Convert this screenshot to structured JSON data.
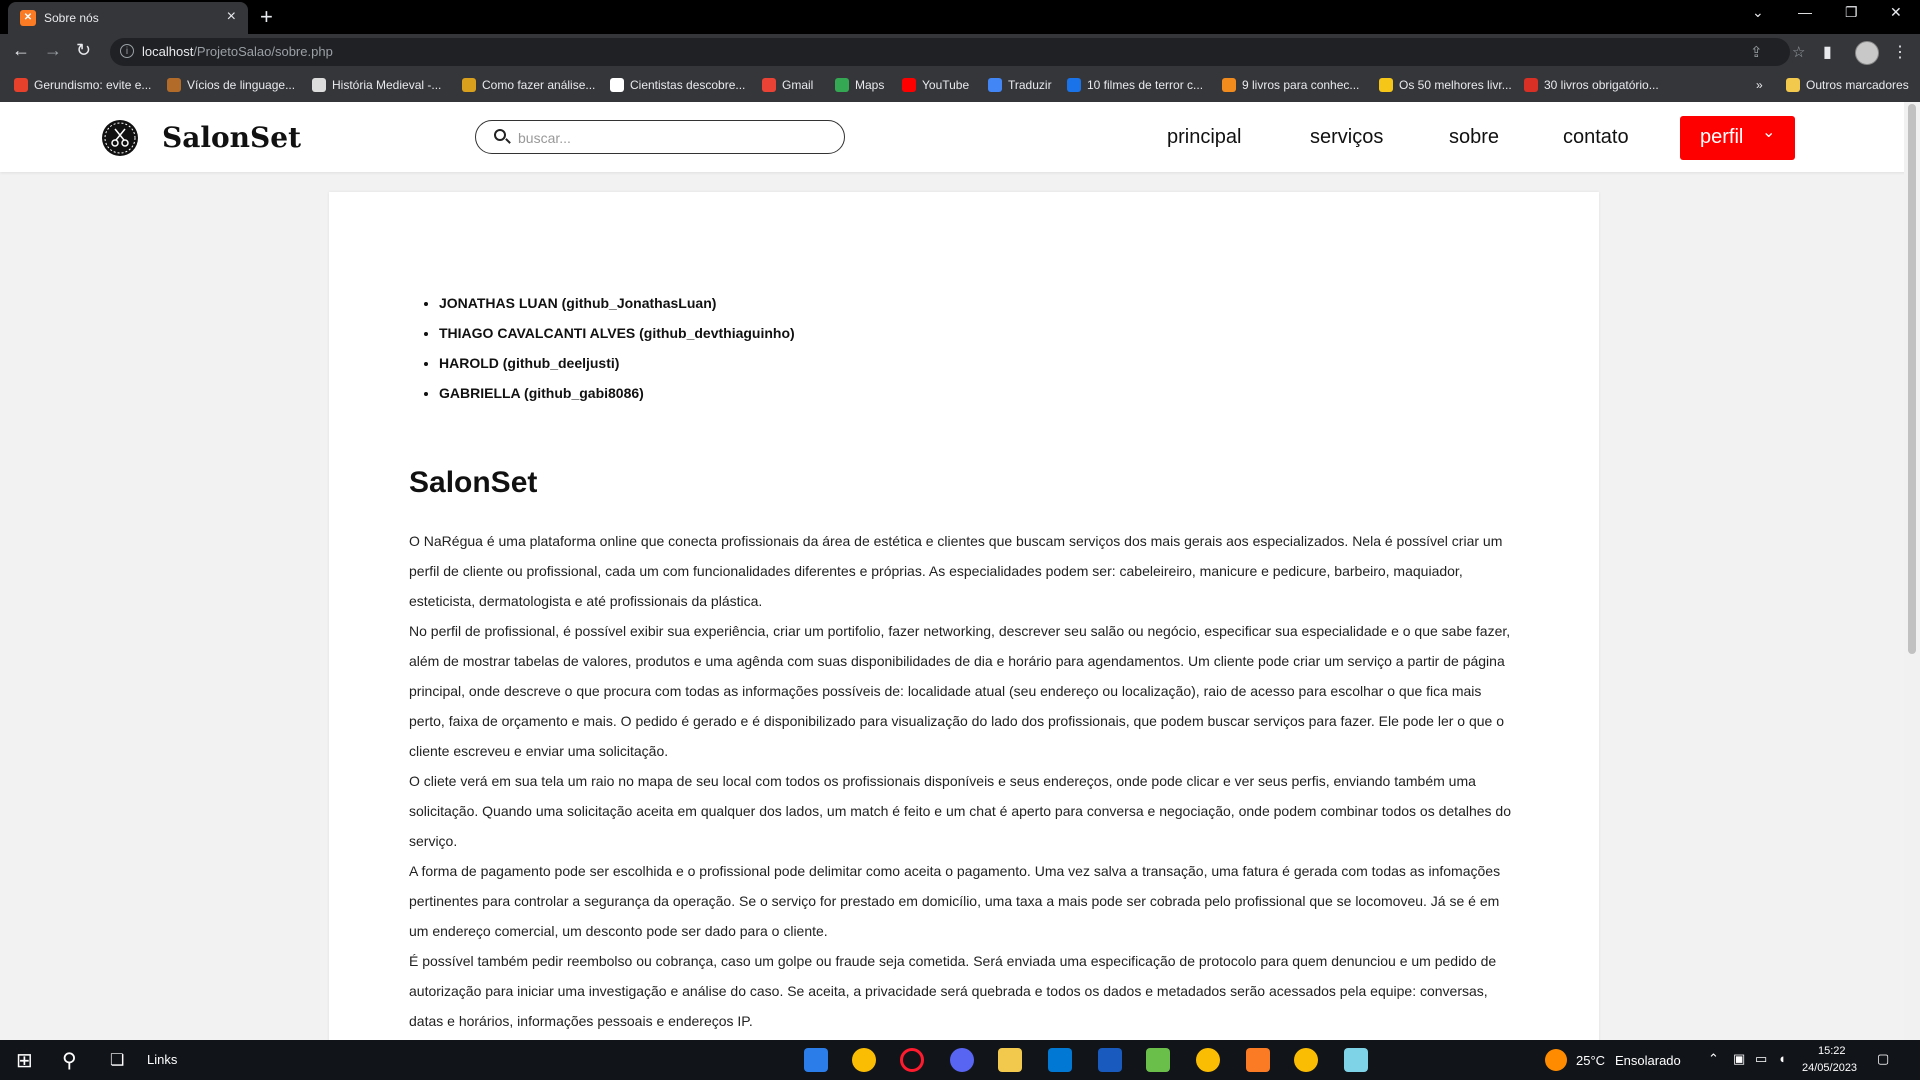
{
  "browser": {
    "tab_title": "Sobre nós",
    "url_host": "localhost",
    "url_path": "/ProjetoSalao/sobre.php",
    "bookmarks": [
      {
        "label": "Gerundismo: evite e...",
        "color": "#e8412b"
      },
      {
        "label": "Vícios de linguage...",
        "color": "#b36b2a"
      },
      {
        "label": "História Medieval -...",
        "color": "#dddddd"
      },
      {
        "label": "Como fazer análise...",
        "color": "#d9a01e"
      },
      {
        "label": "Cientistas descobre...",
        "color": "#ffffff"
      },
      {
        "label": "Gmail",
        "color": "#ea4335"
      },
      {
        "label": "Maps",
        "color": "#34a853"
      },
      {
        "label": "YouTube",
        "color": "#ff0000"
      },
      {
        "label": "Traduzir",
        "color": "#4285f4"
      },
      {
        "label": "10 filmes de terror c...",
        "color": "#1a73e8"
      },
      {
        "label": "9 livros para conhec...",
        "color": "#f28b1e"
      },
      {
        "label": "Os 50 melhores livr...",
        "color": "#f5c518"
      },
      {
        "label": "30 livros obrigatório...",
        "color": "#d93025"
      }
    ],
    "other_bookmarks": "Outros marcadores"
  },
  "site": {
    "logo": "SalonSet",
    "search_placeholder": "buscar...",
    "nav": [
      "principal",
      "serviços",
      "sobre",
      "contato"
    ],
    "profile_label": "perfil",
    "accent_color": "#ff0000"
  },
  "content": {
    "members": [
      "JONATHAS LUAN (github_JonathasLuan)",
      "THIAGO CAVALCANTI ALVES (github_devthiaguinho)",
      "HAROLD (github_deeljusti)",
      "GABRIELLA (github_gabi8086)"
    ],
    "title": "SalonSet",
    "paragraphs": [
      "O NaRégua é uma plataforma online que conecta profissionais da área de estética e clientes que buscam serviços dos mais gerais aos especializados. Nela é possível criar um perfil de cliente ou profissional, cada um com funcionalidades diferentes e próprias. As especialidades podem ser: cabeleireiro, manicure e pedicure, barbeiro, maquiador, esteticista, dermatologista e até profissionais da plástica.",
      "No perfil de profissional, é possível exibir sua experiência, criar um portifolio, fazer networking, descrever seu salão ou negócio, especificar sua especialidade e o que sabe fazer, além de mostrar tabelas de valores, produtos e uma agênda com suas disponibilidades de dia e horário para agendamentos. Um cliente pode criar um serviço a partir de página principal, onde descreve o que procura com todas as informações possíveis de: localidade atual (seu endereço ou localização), raio de acesso para escolhar o que fica mais perto, faixa de orçamento e mais. O pedido é gerado e é disponibilizado para visualização do lado dos profissionais, que podem buscar serviços para fazer. Ele pode ler o que o cliente escreveu e enviar uma solicitação.",
      "O cliete verá em sua tela um raio no mapa de seu local com todos os profissionais disponíveis e seus endereços, onde pode clicar e ver seus perfis, enviando também uma solicitação. Quando uma solicitação aceita em qualquer dos lados, um match é feito e um chat é aperto para conversa e negociação, onde podem combinar todos os detalhes do serviço.",
      "A forma de pagamento pode ser escolhida e o profissional pode delimitar como aceita o pagamento. Uma vez salva a transação, uma fatura é gerada com todas as infomações pertinentes para controlar a segurança da operação. Se o serviço for prestado em domicílio, uma taxa a mais pode ser cobrada pelo profissional que se locomoveu. Já se é em um endereço comercial, um desconto pode ser dado para o cliente.",
      "É possível também pedir reembolso ou cobrança, caso um golpe ou fraude seja cometida. Será enviada uma especificação de protocolo para quem denunciou e um pedido de autorização para iniciar uma investigação e análise do caso. Se aceita, a privacidade será quebrada e todos os dados e metadados serão acessados pela equipe: conversas, datas e horários, informações pessoais e endereços IP."
    ]
  },
  "taskbar": {
    "links_label": "Links",
    "weather_temp": "25°C",
    "weather_desc": "Ensolarado",
    "time": "15:22",
    "date": "24/05/2023"
  }
}
